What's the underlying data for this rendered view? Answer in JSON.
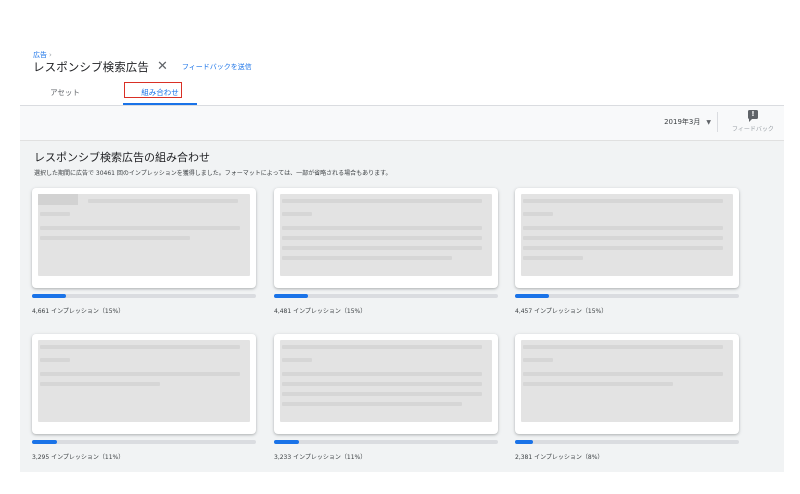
{
  "breadcrumb": {
    "label": "広告",
    "separator": "›"
  },
  "header": {
    "title": "レスポンシブ検索広告",
    "close_glyph": "✕",
    "feedback_link": "フィードバックを送信"
  },
  "tabs": [
    {
      "label": "アセット",
      "active": false
    },
    {
      "label": "組み合わせ",
      "active": true
    }
  ],
  "toolbar": {
    "date": "2019年3月",
    "date_caret": "▼",
    "feedback_icon": "!",
    "feedback_label": "フィードバック"
  },
  "section": {
    "title": "レスポンシブ検索広告の組み合わせ",
    "description": "選択した期間に広告で 30461 回のインプレッションを獲得しました。フォーマットによっては、一部が省略される場合もあります。"
  },
  "cards": [
    {
      "impressions": "4,661 インプレッション（15%）",
      "share": 0.15
    },
    {
      "impressions": "4,481 インプレッション（15%）",
      "share": 0.15
    },
    {
      "impressions": "4,457 インプレッション（15%）",
      "share": 0.15
    },
    {
      "impressions": "3,295 インプレッション（11%）",
      "share": 0.11
    },
    {
      "impressions": "3,233 インプレッション（11%）",
      "share": 0.11
    },
    {
      "impressions": "2,381 インプレッション（8%）",
      "share": 0.08
    }
  ],
  "colors": {
    "accent": "#1a73e8",
    "highlight": "#d93025"
  },
  "icons": {
    "close": "close-icon",
    "feedback": "feedback-icon",
    "dropdown": "chevron-down-icon"
  }
}
